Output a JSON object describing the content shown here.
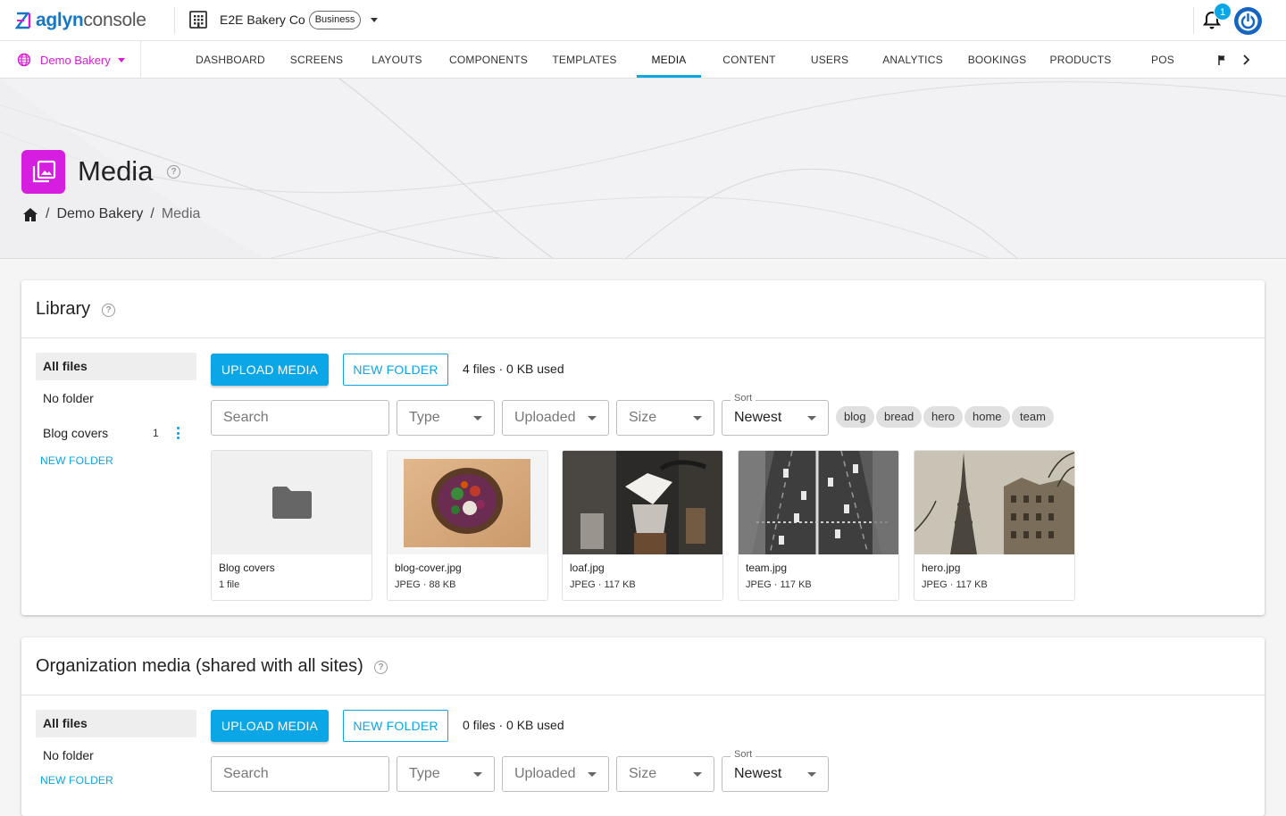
{
  "app": {
    "logo_a": "aglyn",
    "logo_b": "console"
  },
  "org": {
    "name": "E2E Bakery Co",
    "plan": "Business"
  },
  "notifications": {
    "count": "1"
  },
  "site": {
    "name": "Demo Bakery"
  },
  "nav": {
    "tabs": [
      "DASHBOARD",
      "SCREENS",
      "LAYOUTS",
      "COMPONENTS",
      "TEMPLATES",
      "MEDIA",
      "CONTENT",
      "USERS",
      "ANALYTICS",
      "BOOKINGS",
      "PRODUCTS",
      "POS"
    ],
    "active": "MEDIA"
  },
  "page": {
    "title": "Media"
  },
  "breadcrumb": {
    "sep": "/",
    "items": [
      "Demo Bakery",
      "Media"
    ]
  },
  "library": {
    "title": "Library",
    "sidebar": {
      "all": "All files",
      "no_folder": "No folder",
      "folder_name": "Blog covers",
      "folder_count": "1",
      "new_folder": "NEW FOLDER"
    },
    "upload": "UPLOAD MEDIA",
    "new_folder": "NEW FOLDER",
    "usage": "4 files · 0 KB used",
    "filters": {
      "search": "Search",
      "type": "Type",
      "uploaded": "Uploaded",
      "size": "Size",
      "sort_label": "Sort",
      "sort": "Newest"
    },
    "tags": [
      "blog",
      "bread",
      "hero",
      "home",
      "team"
    ],
    "items": [
      {
        "name": "Blog covers",
        "meta": "1 file",
        "kind": "folder-icon"
      },
      {
        "name": "blog-cover.jpg",
        "meta": "JPEG · 88 KB"
      },
      {
        "name": "loaf.jpg",
        "meta": "JPEG · 117 KB"
      },
      {
        "name": "team.jpg",
        "meta": "JPEG · 117 KB"
      },
      {
        "name": "hero.jpg",
        "meta": "JPEG · 117 KB"
      }
    ]
  },
  "org_media": {
    "title": "Organization media (shared with all sites)",
    "sidebar": {
      "all": "All files",
      "no_folder": "No folder",
      "new_folder": "NEW FOLDER"
    },
    "upload": "UPLOAD MEDIA",
    "new_folder": "NEW FOLDER",
    "usage": "0 files · 0 KB used",
    "filters": {
      "search": "Search",
      "type": "Type",
      "uploaded": "Uploaded",
      "size": "Size",
      "sort_label": "Sort",
      "sort": "Newest"
    }
  },
  "colors": {
    "accent": "#0aa6e6",
    "brand_magenta": "#d61ee0",
    "primary_blue": "#1565c0"
  }
}
